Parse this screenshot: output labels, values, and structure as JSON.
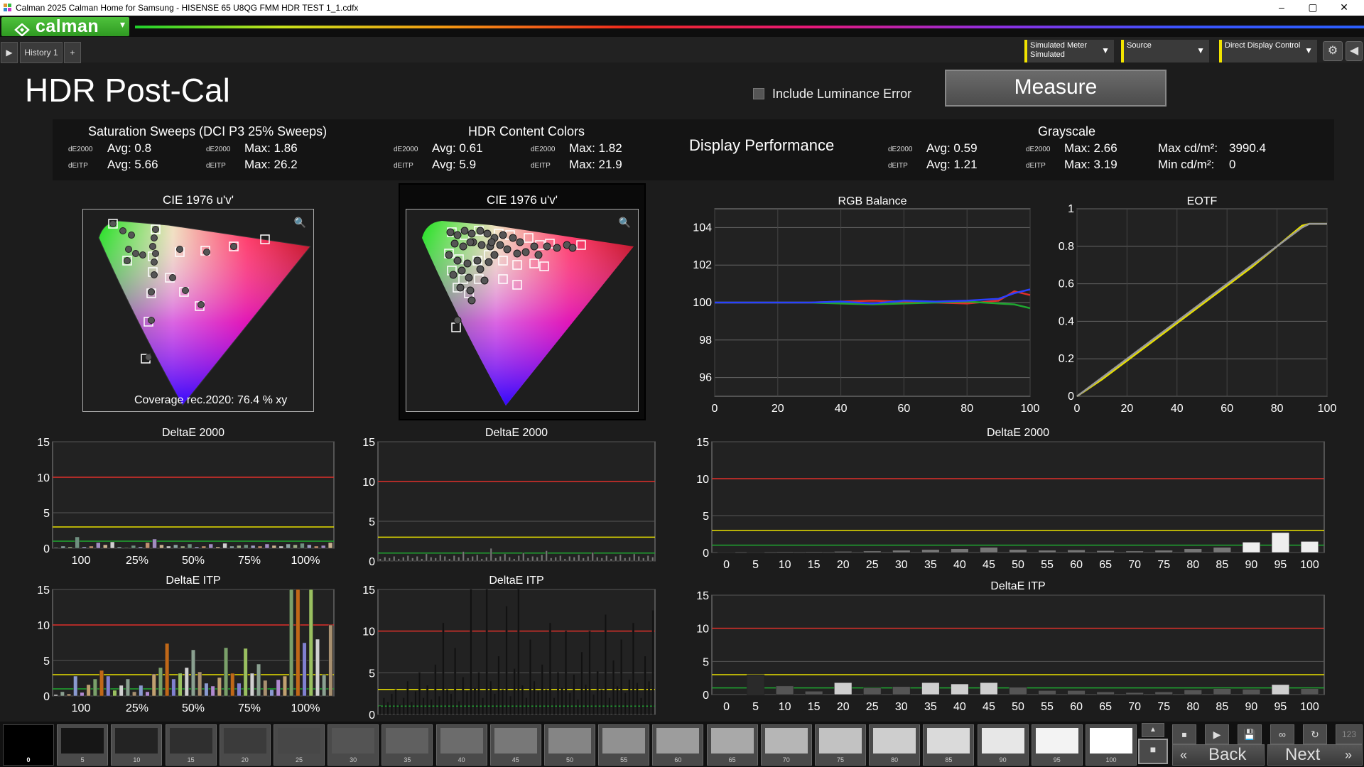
{
  "window": {
    "title": "Calman 2025 Calman Home for Samsung  - HISENSE 65 U8QG FMM HDR TEST 1_1.cdfx",
    "minimize": "–",
    "maximize": "▢",
    "close": "✕"
  },
  "toolbar": {
    "logo_text": "calman",
    "logo_dropdown": "▾"
  },
  "tabs": {
    "history": "History 1",
    "add": "+"
  },
  "controls": {
    "meter_line1": "Simulated Meter",
    "meter_line2": "Simulated",
    "source": "Source",
    "display": "Direct Display Control"
  },
  "page": {
    "title": "HDR Post-Cal",
    "include_luminance_error": "Include Luminance Error",
    "measure_button": "Measure"
  },
  "stats": {
    "saturation": {
      "title": "Saturation Sweeps (DCI P3 25% Sweeps)",
      "de2000_label": "dE2000",
      "deitp_label": "dEITP",
      "avg_de2000": "Avg: 0.8",
      "max_de2000": "Max: 1.86",
      "avg_deitp": "Avg: 5.66",
      "max_deitp": "Max: 26.2"
    },
    "hdr_content": {
      "title": "HDR Content Colors",
      "avg_de2000": "Avg: 0.61",
      "max_de2000": "Max: 1.82",
      "avg_deitp": "Avg: 5.9",
      "max_deitp": "Max: 21.9"
    },
    "display_performance": "Display Performance",
    "grayscale": {
      "title": "Grayscale",
      "avg_de2000": "Avg: 0.59",
      "max_de2000": "Max: 2.66",
      "avg_deitp": "Avg: 1.21",
      "max_deitp": "Max: 3.19",
      "max_cd": "Max cd/m²:",
      "max_cd_val": "3990.4",
      "min_cd": "Min cd/m²:",
      "min_cd_val": "0"
    }
  },
  "cie_left": {
    "title": "CIE 1976 u'v'",
    "coverage": "Coverage rec.2020:  76.4 % xy"
  },
  "cie_mid": {
    "title": "CIE 1976 u'v'"
  },
  "colors": {
    "red_line": "#e0302a",
    "yellow_line": "#e8e000",
    "green_line": "#1fa830",
    "bar_gray": "#9aa0a0",
    "accent": "#f2e400"
  },
  "chart_data": [
    {
      "type": "line",
      "title": "RGB Balance",
      "x": [
        0,
        10,
        20,
        30,
        40,
        50,
        60,
        70,
        80,
        90,
        95,
        100
      ],
      "series": [
        {
          "values": [
            100,
            100,
            100,
            100,
            100.05,
            100.1,
            100.05,
            100,
            99.95,
            100.1,
            100.6,
            100.4
          ]
        },
        {
          "values": [
            100,
            100,
            100,
            100,
            99.95,
            99.9,
            99.95,
            100,
            100.05,
            99.95,
            99.9,
            99.7
          ]
        },
        {
          "values": [
            100,
            100,
            100,
            100,
            100.05,
            99.95,
            100.1,
            100.05,
            100.1,
            100.2,
            100.5,
            100.7
          ]
        }
      ],
      "xlim": [
        0,
        100
      ],
      "ylim": [
        95,
        105
      ],
      "yticks": [
        96,
        98,
        100,
        102,
        104
      ],
      "xticks": [
        0,
        20,
        40,
        60,
        80,
        100
      ]
    },
    {
      "type": "line",
      "title": "EOTF",
      "x": [
        0,
        10,
        20,
        30,
        40,
        50,
        60,
        70,
        80,
        90,
        93,
        100
      ],
      "series": [
        {
          "values": [
            0,
            0.09,
            0.19,
            0.29,
            0.39,
            0.49,
            0.59,
            0.69,
            0.8,
            0.91,
            0.92,
            0.92
          ]
        },
        {
          "values": [
            0,
            0.1,
            0.2,
            0.3,
            0.4,
            0.5,
            0.6,
            0.7,
            0.8,
            0.9,
            0.92,
            0.92
          ]
        }
      ],
      "xlim": [
        0,
        100
      ],
      "ylim": [
        0,
        1
      ],
      "yticks": [
        0,
        0.2,
        0.4,
        0.6,
        0.8,
        1
      ],
      "xticks": [
        0,
        20,
        40,
        60,
        80,
        100
      ]
    },
    {
      "type": "bar",
      "title": "DeltaE 2000",
      "categories": [
        "100",
        "25%",
        "50%",
        "75%",
        "100%"
      ],
      "values": [
        0.1,
        0.3,
        0.2,
        1.6,
        0.2,
        0.3,
        0.8,
        0.5,
        0.9,
        0.2,
        0.1,
        0.4,
        0.2,
        0.8,
        1.3,
        0.5,
        0.3,
        0.5,
        0.3,
        0.6,
        0.2,
        0.3,
        0.6,
        0.2,
        0.7,
        0.3,
        0.4,
        0.5,
        0.4,
        0.3,
        0.6,
        0.4,
        0.3,
        0.6,
        0.5,
        0.7,
        0.5,
        0.3,
        0.4,
        0.8
      ],
      "ylim": [
        0,
        15
      ],
      "yticks": [
        0,
        5,
        10,
        15
      ]
    },
    {
      "type": "bar",
      "title": "DeltaE 2000",
      "values": [
        0.3,
        0.5,
        0.4,
        0.6,
        0.3,
        0.5,
        0.7,
        0.4,
        0.6,
        0.3,
        0.9,
        0.5,
        0.4,
        0.8,
        0.6,
        0.3,
        0.7,
        0.5,
        1.2,
        0.4,
        0.6,
        0.8,
        0.3,
        0.5,
        1.6,
        0.4,
        0.6,
        0.9,
        0.5,
        0.3,
        0.7,
        1.0,
        0.4,
        0.6,
        0.5,
        0.8,
        1.3,
        0.4,
        0.5,
        0.7,
        0.3,
        0.6,
        0.5,
        0.8,
        0.4,
        0.6,
        1.1,
        0.5,
        0.4,
        0.7,
        0.3,
        0.6,
        0.8,
        0.4,
        0.5,
        0.9,
        0.6,
        0.4,
        0.7,
        0.5
      ],
      "ylim": [
        0,
        15
      ],
      "yticks": [
        0,
        5,
        10,
        15
      ]
    },
    {
      "type": "bar",
      "title": "DeltaE 2000",
      "categories": [
        "0",
        "5",
        "10",
        "15",
        "20",
        "25",
        "30",
        "35",
        "40",
        "45",
        "50",
        "55",
        "60",
        "65",
        "70",
        "75",
        "80",
        "85",
        "90",
        "95",
        "100"
      ],
      "values": [
        0.05,
        0.05,
        0.1,
        0.1,
        0.15,
        0.2,
        0.3,
        0.4,
        0.5,
        0.7,
        0.4,
        0.3,
        0.35,
        0.25,
        0.2,
        0.3,
        0.5,
        0.7,
        1.4,
        2.7,
        1.5
      ],
      "ylim": [
        0,
        15
      ],
      "yticks": [
        0,
        5,
        10,
        15
      ]
    },
    {
      "type": "bar",
      "title": "DeltaE ITP",
      "categories": [
        "100",
        "25%",
        "50%",
        "75%",
        "100%"
      ],
      "values": [
        0.2,
        0.6,
        0.3,
        2.8,
        0.5,
        1.6,
        2.4,
        3.6,
        2.8,
        0.8,
        1.5,
        2.4,
        0.6,
        1.5,
        0.6,
        3.1,
        4.0,
        7.4,
        2.4,
        3.2,
        4.0,
        6.5,
        3.4,
        1.8,
        1.4,
        2.6,
        6.8,
        3.2,
        1.8,
        6.7,
        3.2,
        4.5,
        2.2,
        0.9,
        2.3,
        2.8,
        15,
        15,
        7.5,
        15,
        8,
        3,
        10
      ],
      "ylim": [
        0,
        15
      ],
      "yticks": [
        0,
        5,
        10,
        15
      ]
    },
    {
      "type": "bar",
      "title": "DeltaE ITP",
      "values": [
        1,
        2,
        1.5,
        2.5,
        3,
        1.2,
        2,
        4,
        1.5,
        2.8,
        5,
        2,
        3.5,
        1.8,
        6,
        2.2,
        11,
        3,
        2.5,
        8,
        1.6,
        4.5,
        2.8,
        15,
        3.2,
        5,
        2,
        15,
        4,
        2.5,
        7,
        3,
        13,
        2.2,
        5.5,
        15,
        3.5,
        2,
        9,
        4,
        2.8,
        6,
        3,
        11,
        2,
        5,
        3.2,
        10,
        2.6,
        4.8,
        1.8,
        7.5,
        3.6,
        10,
        2.4,
        5.2,
        3,
        12,
        2,
        6.5,
        3.4,
        9,
        2.6,
        4.2,
        11,
        3.8,
        2,
        7,
        4,
        12.5
      ],
      "ylim": [
        0,
        15
      ],
      "yticks": [
        0,
        5,
        10,
        15
      ]
    },
    {
      "type": "bar",
      "title": "DeltaE ITP",
      "categories": [
        "0",
        "5",
        "10",
        "15",
        "20",
        "25",
        "30",
        "35",
        "40",
        "45",
        "50",
        "55",
        "60",
        "65",
        "70",
        "75",
        "80",
        "85",
        "90",
        "95",
        "100"
      ],
      "values": [
        0,
        3,
        1.3,
        0.5,
        1.8,
        1.0,
        1.2,
        1.8,
        1.6,
        1.8,
        1.1,
        0.6,
        0.6,
        0.4,
        0.3,
        0.4,
        0.7,
        0.9,
        0.8,
        1.5,
        0.9
      ],
      "ylim": [
        0,
        15
      ],
      "yticks": [
        0,
        5,
        10,
        15
      ]
    }
  ],
  "swatches": [
    "0",
    "5",
    "10",
    "15",
    "20",
    "25",
    "30",
    "35",
    "40",
    "45",
    "50",
    "55",
    "60",
    "65",
    "70",
    "75",
    "80",
    "85",
    "90",
    "95",
    "100"
  ],
  "nav": {
    "back": "Back",
    "next": "Next",
    "count": "123"
  }
}
